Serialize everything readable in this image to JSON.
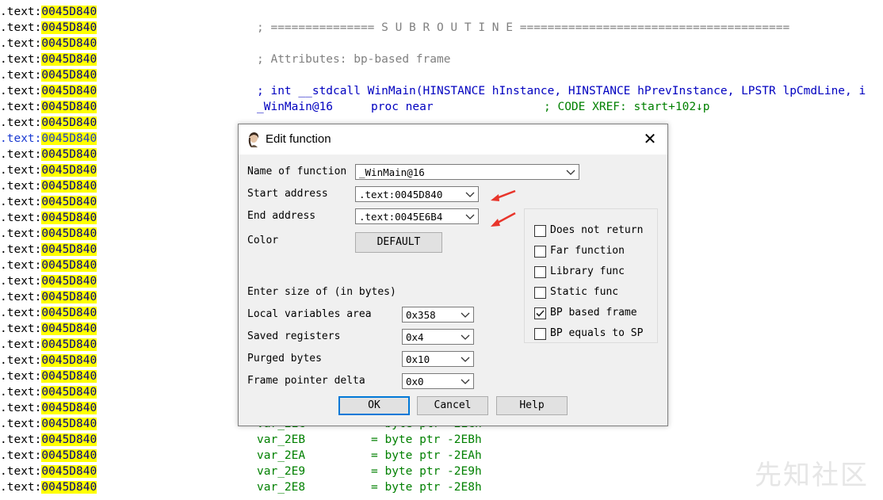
{
  "listing": {
    "segment": ".text:",
    "address": "0045D840",
    "row_count": 31,
    "selected_row": 8,
    "subroutine_line": "; =============== S U B R O U T I N E =======================================",
    "attributes_line": "; Attributes: bp-based frame",
    "signature_line": "; int __stdcall WinMain(HINSTANCE hInstance, HINSTANCE hPrevInstance, LPSTR lpCmdLine, i",
    "proc_name": "_WinMain@16",
    "proc_kw": "proc near",
    "xref": "; CODE XREF: start+102↓p",
    "vars": [
      {
        "name": "var_2EC",
        "def": "= byte ptr -2ECh"
      },
      {
        "name": "var_2EB",
        "def": "= byte ptr -2EBh"
      },
      {
        "name": "var_2EA",
        "def": "= byte ptr -2EAh"
      },
      {
        "name": "var_2E9",
        "def": "= byte ptr -2E9h"
      },
      {
        "name": "var_2E8",
        "def": "= byte ptr -2E8h"
      }
    ]
  },
  "dialog": {
    "title": "Edit function",
    "close_glyph": "✕",
    "name_label": "Name of function",
    "name_value": "_WinMain@16",
    "start_label": "Start address",
    "start_value": ".text:0045D840",
    "end_label": "End address",
    "end_value": ".text:0045E6B4",
    "color_label": "Color",
    "color_button": "DEFAULT",
    "size_heading": "Enter size of (in bytes)",
    "local_label": "Local variables area",
    "local_value": "0x358",
    "saved_label": "Saved registers",
    "saved_value": "0x4",
    "purged_label": "Purged bytes",
    "purged_value": "0x10",
    "fpd_label": "Frame pointer delta",
    "fpd_value": "0x0",
    "checkboxes": [
      {
        "label": "Does not return",
        "checked": false
      },
      {
        "label": "Far function",
        "checked": false
      },
      {
        "label": "Library func",
        "checked": false
      },
      {
        "label": "Static func",
        "checked": false
      },
      {
        "label": "BP based frame",
        "checked": true
      },
      {
        "label": "BP equals to SP",
        "checked": false
      }
    ],
    "ok": "OK",
    "cancel": "Cancel",
    "help": "Help",
    "arrow_color": "#e8352b"
  },
  "watermark": "先知社区",
  "colors": {
    "address_highlight": "#ffff00",
    "code_blue": "#0000c0",
    "comment_gray": "#808080",
    "xref_green": "#008000"
  }
}
